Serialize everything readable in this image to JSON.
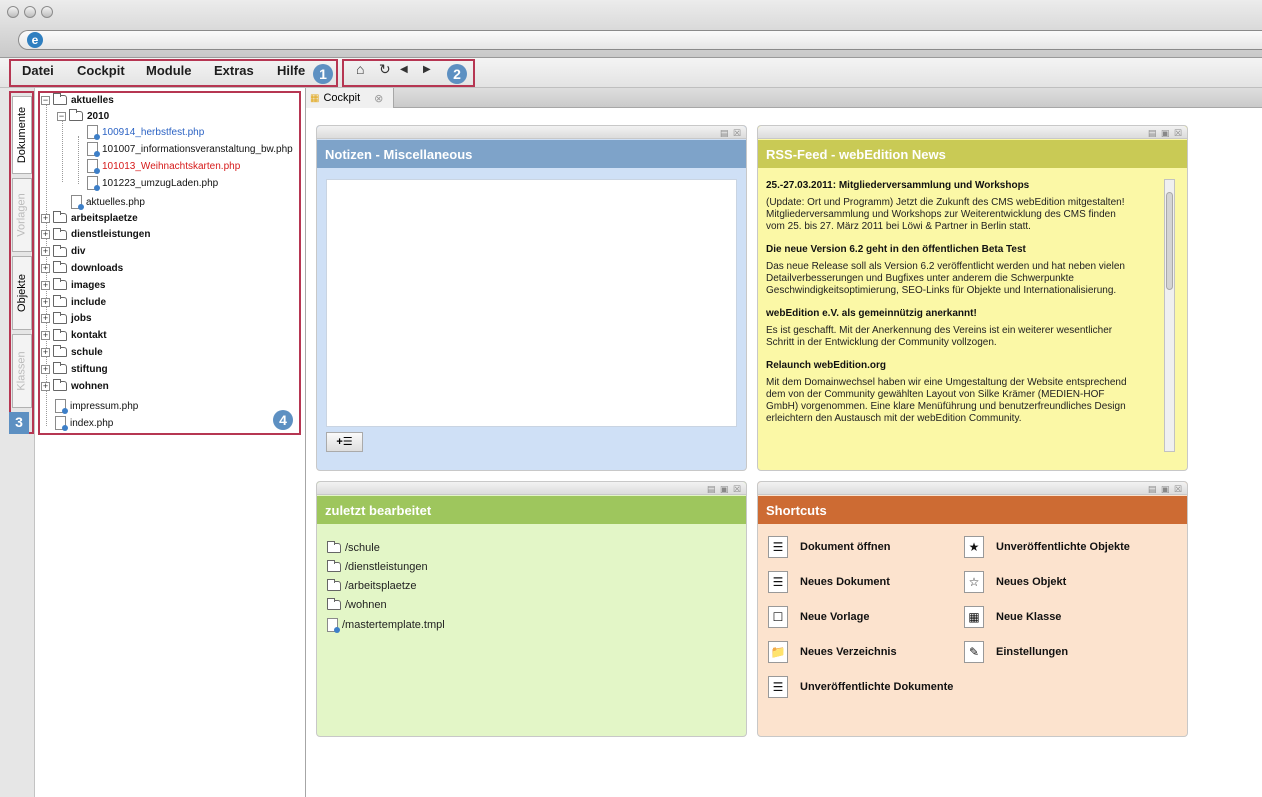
{
  "menu": {
    "items": [
      "Datei",
      "Cockpit",
      "Module",
      "Extras",
      "Hilfe"
    ],
    "badge": "1"
  },
  "nav": {
    "badge": "2"
  },
  "vtabs": {
    "items": [
      "Dokumente",
      "Vorlagen",
      "Objekte",
      "Klassen"
    ],
    "badge": "3"
  },
  "tree": {
    "badge": "4",
    "root": "aktuelles",
    "sub": "2010",
    "files2010": [
      {
        "name": "100914_herbstfest.php",
        "color": "#2c63c4"
      },
      {
        "name": "101007_informationsveranstaltung_bw.php",
        "color": "#111111"
      },
      {
        "name": "101013_Weihnachtskarten.php",
        "color": "#d61a1a"
      },
      {
        "name": "101223_umzugLaden.php",
        "color": "#111111"
      }
    ],
    "aktuelles_file": "aktuelles.php",
    "folders": [
      "arbeitsplaetze",
      "dienstleistungen",
      "div",
      "downloads",
      "images",
      "include",
      "jobs",
      "kontakt",
      "schule",
      "stiftung",
      "wohnen"
    ],
    "files": [
      "impressum.php",
      "index.php"
    ]
  },
  "tab": {
    "label": "Cockpit"
  },
  "notes": {
    "title": "Notizen - Miscellaneous",
    "add_label": "+☰",
    "color": "#7ea3c9"
  },
  "rss": {
    "title": "RSS-Feed - webEdition News",
    "color": "#c9ca55",
    "entries": [
      {
        "heading": "25.-27.03.2011: Mitgliederversammlung und Workshops",
        "lines": [
          "(Update: Ort und Programm) Jetzt die Zukunft des CMS webEdition mitgestalten!",
          "Mitgliederversammlung und Workshops zur Weiterentwicklung des CMS finden",
          "vom 25. bis 27. März 2011 bei Löwi & Partner in Berlin statt."
        ]
      },
      {
        "heading": "Die neue Version 6.2 geht in den öffentlichen Beta Test",
        "lines": [
          "Das neue Release soll als Version 6.2 veröffentlicht werden und hat neben vielen",
          "Detailverbesserungen und Bugfixes unter anderem die Schwerpunkte",
          "Geschwindigkeitsoptimierung, SEO-Links für Objekte und Internationalisierung."
        ]
      },
      {
        "heading": "webEdition e.V. als gemeinnützig anerkannt!",
        "lines": [
          "Es ist geschafft. Mit der Anerkennung des Vereins ist ein weiterer wesentlicher",
          "Schritt in der Entwicklung der Community vollzogen."
        ]
      },
      {
        "heading": "Relaunch webEdition.org",
        "lines": [
          "Mit dem Domainwechsel haben wir eine Umgestaltung der Website entsprechend",
          "dem von der Community gewählten Layout von Silke Krämer (MEDIEN-HOF",
          "GmbH) vorgenommen. Eine klare Menüführung und benutzerfreundliches Design",
          "erleichtern den Austausch mit der webEdition Community."
        ]
      }
    ]
  },
  "recent": {
    "title": "zuletzt bearbeitet",
    "color": "#9ec65d",
    "items": [
      "/schule",
      "/dienstleistungen",
      "/arbeitsplaetze",
      "/wohnen",
      "/mastertemplate.tmpl"
    ]
  },
  "shortcuts": {
    "title": "Shortcuts",
    "color": "#cd6b33",
    "left": [
      "Dokument öffnen",
      "Neues Dokument",
      "Neue Vorlage",
      "Neues Verzeichnis",
      "Unveröffentlichte Dokumente"
    ],
    "right": [
      "Unveröffentlichte Objekte",
      "Neues Objekt",
      "Neue Klasse",
      "Einstellungen"
    ]
  }
}
